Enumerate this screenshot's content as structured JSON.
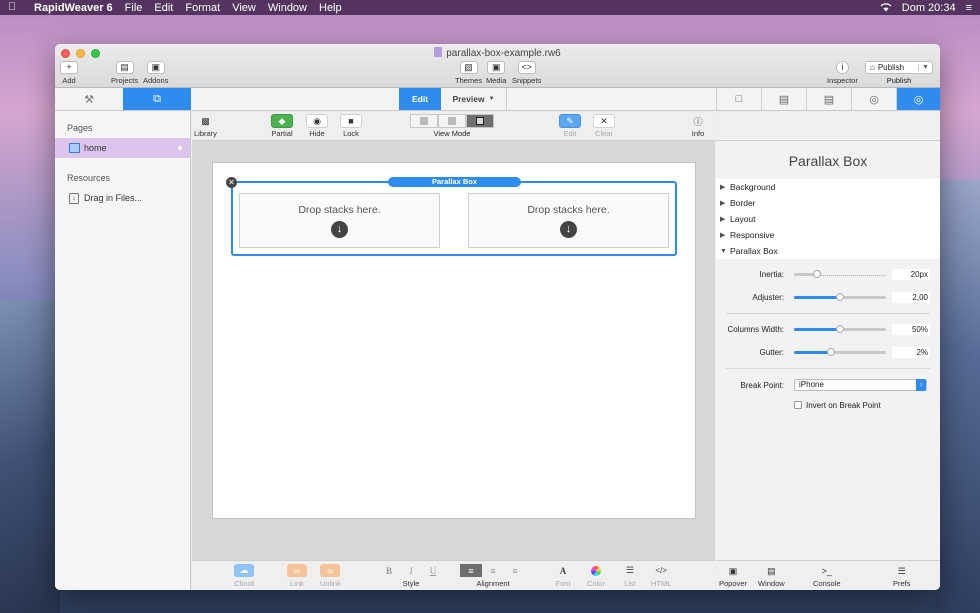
{
  "menubar": {
    "app_name": "RapidWeaver 6",
    "items": [
      "File",
      "Edit",
      "Format",
      "View",
      "Window",
      "Help"
    ],
    "clock": "Dom 20:34"
  },
  "window": {
    "title": "parallax-box-example.rw6",
    "toolbar": {
      "add": "Add",
      "projects": "Projects",
      "addons": "Addons",
      "themes": "Themes",
      "media": "Media",
      "snippets": "Snippets",
      "inspector": "Inspector",
      "publish_button": "Publish",
      "publish_label": "Publish"
    }
  },
  "modes": {
    "edit": "Edit",
    "preview": "Preview"
  },
  "sidebar": {
    "pages_heading": "Pages",
    "pages": [
      {
        "label": "home"
      }
    ],
    "resources_heading": "Resources",
    "resources": [
      {
        "label": "Drag in Files..."
      }
    ]
  },
  "main_toolbar": {
    "library": "Library",
    "partial": "Partial",
    "hide": "Hide",
    "lock": "Lock",
    "view_mode": "View Mode",
    "edit": "Edit",
    "clear": "Clear",
    "info": "Info"
  },
  "canvas": {
    "stack_label": "Parallax Box",
    "drop_text_left": "Drop stacks here.",
    "drop_text_right": "Drop stacks here."
  },
  "bottom_bar": {
    "cloud": "Cloud",
    "link": "Link",
    "unlink": "Unlink",
    "style": "Style",
    "alignment": "Alignment",
    "font": "Font",
    "color": "Color",
    "list": "List",
    "html": "HTML",
    "style_bold": "B",
    "style_italic": "I",
    "style_underline": "U"
  },
  "inspector": {
    "title": "Parallax Box",
    "sections": [
      {
        "label": "Background",
        "expanded": false
      },
      {
        "label": "Border",
        "expanded": false
      },
      {
        "label": "Layout",
        "expanded": false
      },
      {
        "label": "Responsive",
        "expanded": false
      },
      {
        "label": "Parallax Box",
        "expanded": true
      }
    ],
    "settings": {
      "inertia_label": "Inertia:",
      "inertia_value": "20px",
      "inertia_level": 0.25,
      "adjuster_label": "Adjuster:",
      "adjuster_value": "2,00",
      "adjuster_level": 0.5,
      "columns_width_label": "Columns Width:",
      "columns_width_value": "50%",
      "columns_width_level": 0.5,
      "gutter_label": "Gutter:",
      "gutter_value": "2%",
      "gutter_level": 0.4,
      "break_point_label": "Break Point:",
      "break_point_value": "iPhone",
      "invert_label": "Invert on Break Point"
    },
    "bottom": {
      "popover": "Popover",
      "window": "Window",
      "console": "Console",
      "prefs": "Prefs"
    }
  },
  "colors": {
    "accent": "#2e8cf0",
    "partial_green": "#4cb24f",
    "selected_page": "#dcc4ec"
  }
}
